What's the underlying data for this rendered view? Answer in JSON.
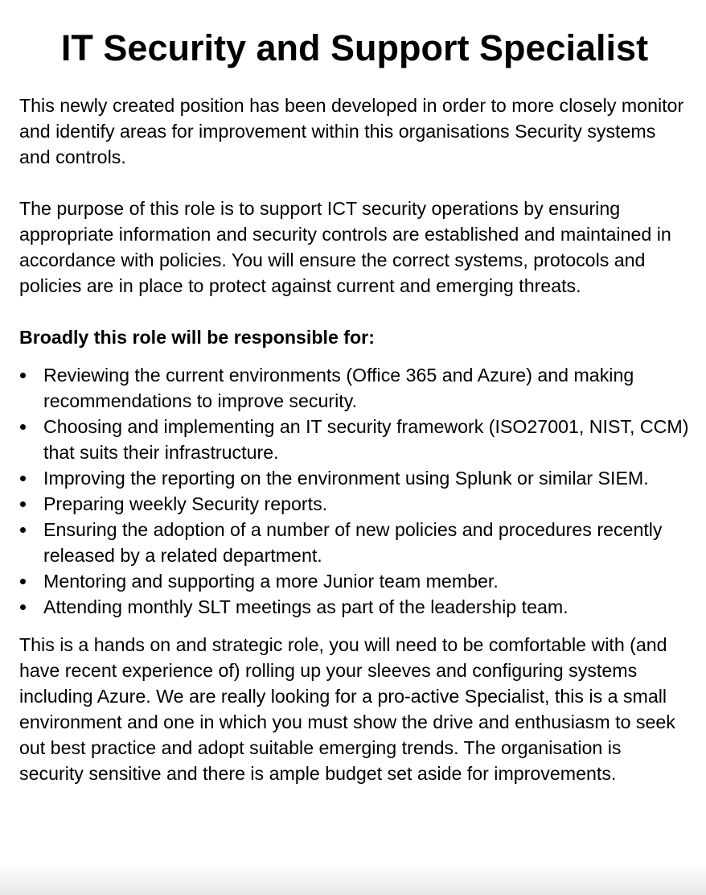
{
  "document": {
    "title": "IT Security and Support Specialist",
    "intro": "This newly created position has been developed in order to more closely monitor and identify areas for improvement within this organisations Security systems and controls.",
    "purpose": "The purpose of this role is to support ICT security operations by ensuring appropriate information and security controls are established and maintained in accordance with policies. You will ensure the correct systems, protocols and policies are in place to protect against current and emerging threats.",
    "responsibilities_heading": "Broadly this role will be responsible for:",
    "responsibilities": [
      "Reviewing the current environments (Office 365 and Azure) and making recommendations to improve security.",
      "Choosing and implementing an IT security framework (ISO27001, NIST, CCM) that suits their infrastructure.",
      "Improving the reporting on the environment using Splunk or similar SIEM.",
      "Preparing weekly Security reports.",
      "Ensuring the adoption of a number of new policies and procedures recently released by a related department.",
      "Mentoring and supporting a more Junior team member.",
      "Attending monthly SLT meetings as part of the leadership team."
    ],
    "closing": "This is a hands on and strategic role, you will need to be comfortable with (and have recent experience of) rolling up your sleeves and configuring systems including Azure. We are really looking for a pro-active Specialist, this is a small environment and one in which you must show the drive and enthusiasm to seek out best practice and adopt suitable emerging trends. The organisation is security sensitive and there is ample budget set aside for improvements."
  }
}
